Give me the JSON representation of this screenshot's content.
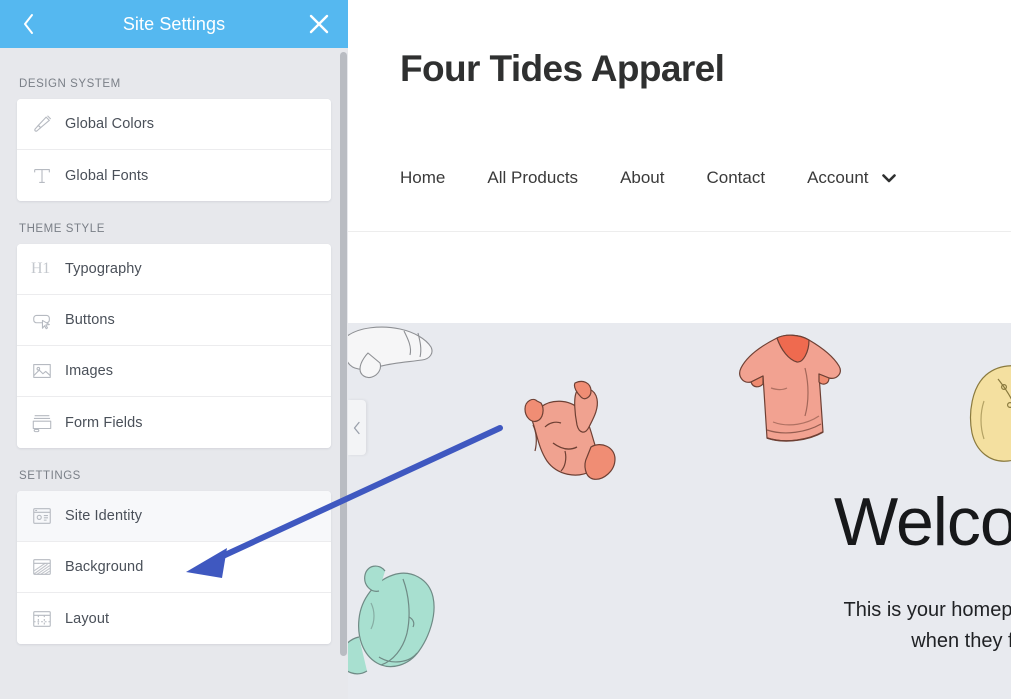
{
  "panel": {
    "title": "Site Settings",
    "back_icon": "chevron-left-icon",
    "close_icon": "close-icon",
    "groups": [
      {
        "label": "DESIGN SYSTEM",
        "items": [
          {
            "label": "Global Colors",
            "icon": "paintbrush-icon",
            "selected": false
          },
          {
            "label": "Global Fonts",
            "icon": "text-t-icon",
            "selected": false
          }
        ]
      },
      {
        "label": "THEME STYLE",
        "items": [
          {
            "label": "Typography",
            "icon": "h1-heading-icon",
            "selected": false
          },
          {
            "label": "Buttons",
            "icon": "button-cursor-icon",
            "selected": false
          },
          {
            "label": "Images",
            "icon": "image-icon",
            "selected": false
          },
          {
            "label": "Form Fields",
            "icon": "form-fields-icon",
            "selected": false
          }
        ]
      },
      {
        "label": "SETTINGS",
        "items": [
          {
            "label": "Site Identity",
            "icon": "site-identity-icon",
            "selected": true
          },
          {
            "label": "Background",
            "icon": "background-icon",
            "selected": false
          },
          {
            "label": "Layout",
            "icon": "layout-grid-icon",
            "selected": false
          }
        ]
      }
    ]
  },
  "preview": {
    "site_logo": "Four Tides Apparel",
    "nav": [
      {
        "label": "Home"
      },
      {
        "label": "All Products"
      },
      {
        "label": "About"
      },
      {
        "label": "Contact"
      },
      {
        "label": "Account"
      }
    ],
    "nav_caret_icon": "chevron-down-icon",
    "collapse_icon": "chevron-left-icon",
    "hero": {
      "title": "Welco",
      "subtitle_line1": "This is your homepage which is w",
      "subtitle_line2": "when they first visi"
    }
  },
  "annotation": {
    "type": "arrow",
    "color": "#3f58c0",
    "points_to": "Site Identity"
  },
  "colors": {
    "header_blue": "#55b8f0",
    "panel_bg": "#e7e8ec",
    "card_bg": "#ffffff",
    "hero_bg": "#e8eaef",
    "label_text": "#7a7f87",
    "item_text": "#4a5059",
    "annotation_blue": "#3f58c0"
  }
}
